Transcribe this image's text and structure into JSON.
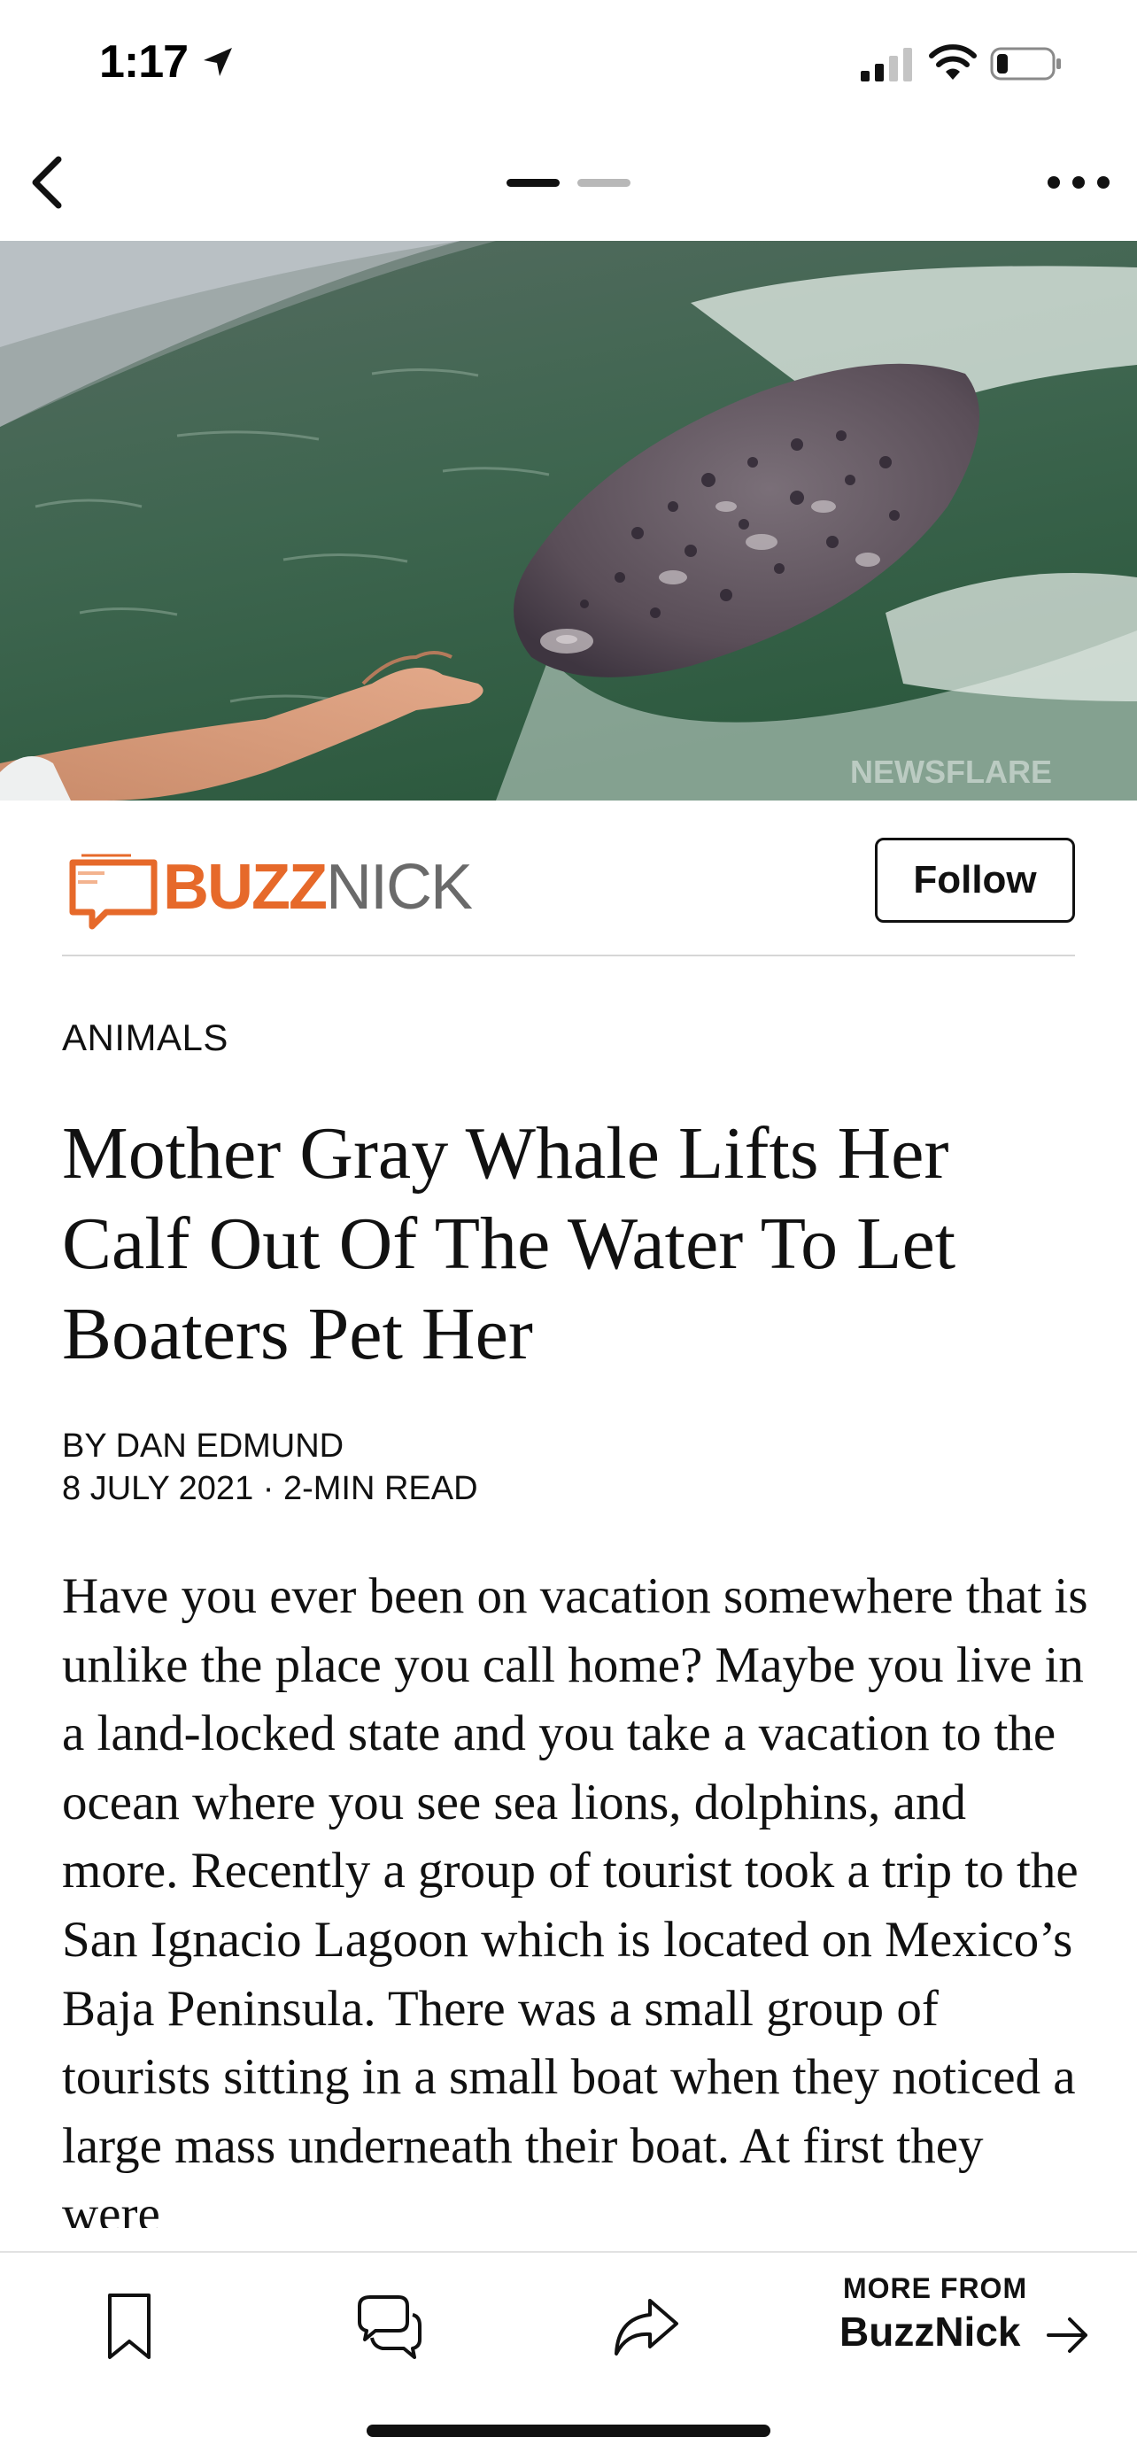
{
  "status_bar": {
    "time": "1:17",
    "location_icon": "location-arrow-icon",
    "signal_icon": "cellular-signal-icon",
    "wifi_icon": "wifi-icon",
    "battery_icon": "battery-low-icon"
  },
  "nav": {
    "back_icon": "chevron-left-icon",
    "more_icon": "ellipsis-icon",
    "pages": {
      "count": 2,
      "active": 1
    }
  },
  "hero": {
    "watermark": "NEWSFLARE"
  },
  "publisher": {
    "name_part_1": "BUZZ",
    "name_part_2": "NICK",
    "follow_label": "Follow",
    "colors": {
      "accent": "#e6692a",
      "secondary": "#6a6a6a"
    }
  },
  "article": {
    "category": "ANIMALS",
    "headline": "Mother Gray Whale Lifts Her Calf Out Of The Water To Let Boaters Pet Her",
    "byline": "BY DAN EDMUND",
    "date": "8 JULY 2021",
    "separator": "·",
    "read_time": "2-MIN READ",
    "body": "Have you ever been on vacation somewhere that is unlike the place you call home? Maybe you live in a land-locked state and you take a vacation to the ocean where you see sea lions, dolphins, and more. Recently a group of tourist took a trip to the San Ignacio Lagoon which is located on Mexico’s Baja Peninsula. There was a small group of tourists sitting in a small boat when they noticed a large mass underneath their boat. At first they were"
  },
  "toolbar": {
    "bookmark_icon": "bookmark-icon",
    "comment_icon": "comment-icon",
    "share_icon": "share-icon",
    "more_from_label": "MORE FROM",
    "more_from_name": "BuzzNick",
    "arrow_icon": "arrow-right-icon"
  }
}
